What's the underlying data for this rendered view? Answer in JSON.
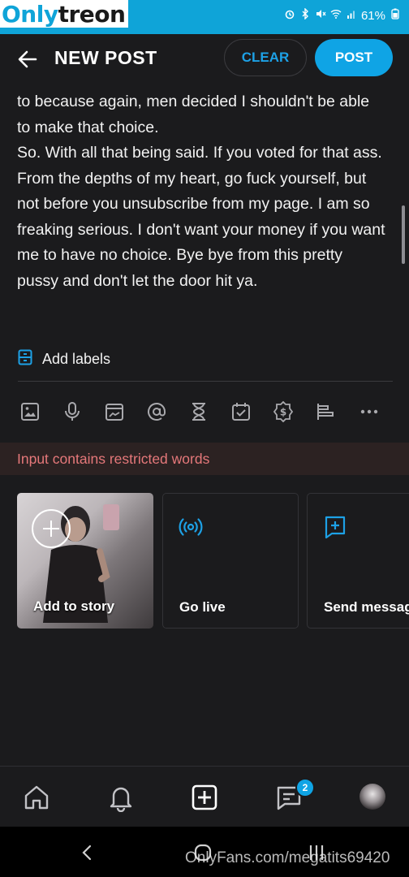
{
  "watermark": {
    "logo_part1": "Only",
    "logo_part2": "treon",
    "url": "OnlyFans.com/megatits69420"
  },
  "status_bar": {
    "battery": "61%"
  },
  "header": {
    "title": "NEW POST",
    "clear_label": "CLEAR",
    "post_label": "POST"
  },
  "post": {
    "lines": [
      "to because again, men decided I shouldn't be able to make that choice.",
      "So. With all that being said. If you voted for that ass. From the depths of my heart, go fuck yourself, but not before you unsubscribe from my page. I am so freaking serious. I don't want your money if you want me to have no choice. Bye bye from this pretty pussy and don't let the door hit ya."
    ]
  },
  "labels": {
    "add_labels": "Add labels"
  },
  "toolbar": {
    "icons": [
      "image-icon",
      "microphone-icon",
      "vault-icon",
      "mention-icon",
      "hourglass-icon",
      "calendar-check-icon",
      "price-icon",
      "poll-icon",
      "more-icon"
    ]
  },
  "warning": {
    "text": "Input contains restricted words"
  },
  "cards": {
    "story": "Add to story",
    "live": "Go live",
    "message": "Send message"
  },
  "bottom_nav": {
    "badge_count": "2"
  },
  "colors": {
    "accent": "#0fa4e5",
    "background": "#1b1b1d",
    "warning_text": "#e5787a",
    "warning_bg": "#2c2222"
  }
}
